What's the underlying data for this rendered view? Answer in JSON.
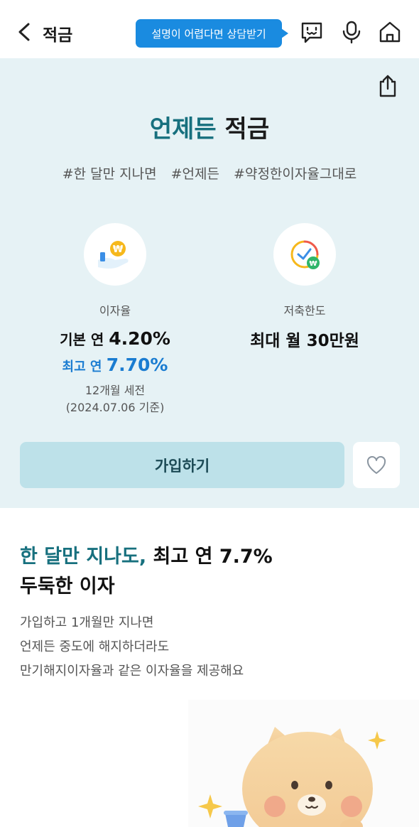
{
  "header": {
    "title": "적금",
    "help_label": "설명이 어렵다면 상담받기",
    "icons": [
      "back-icon",
      "chatbot-icon",
      "mic-icon",
      "home-icon"
    ]
  },
  "hero": {
    "title_accent": "언제든",
    "title_rest": " 적금",
    "tags": [
      "#한 달만 지나면",
      "#언제든",
      "#약정한이자율그대로"
    ],
    "rate": {
      "label": "이자율",
      "base_prefix": "기본 연 ",
      "base_value": "4.20%",
      "max_prefix": "최고 연 ",
      "max_value": "7.70%",
      "term": "12개월 세전",
      "date_note": "(2024.07.06 기준)"
    },
    "limit": {
      "label": "저축한도",
      "value": "최대 월 30만원"
    },
    "join_label": "가입하기",
    "icons": [
      "share-icon",
      "heart-icon"
    ]
  },
  "content": {
    "headline_accent": "한 달만 지나도,",
    "headline_rest": " 최고 연 7.7%",
    "headline_line2": "두둑한 이자",
    "desc_lines": [
      "가입하고 1개월만 지나면",
      "언제든 중도에 해지하더라도",
      "만기해지이자율과 같은 이자율을 제공해요"
    ]
  },
  "colors": {
    "accent": "#17707e",
    "highlight_blue": "#1a7cd1",
    "help_bubble": "#1a8be0",
    "hero_bg": "#e6f2f5",
    "join_button": "#bde1e9"
  }
}
